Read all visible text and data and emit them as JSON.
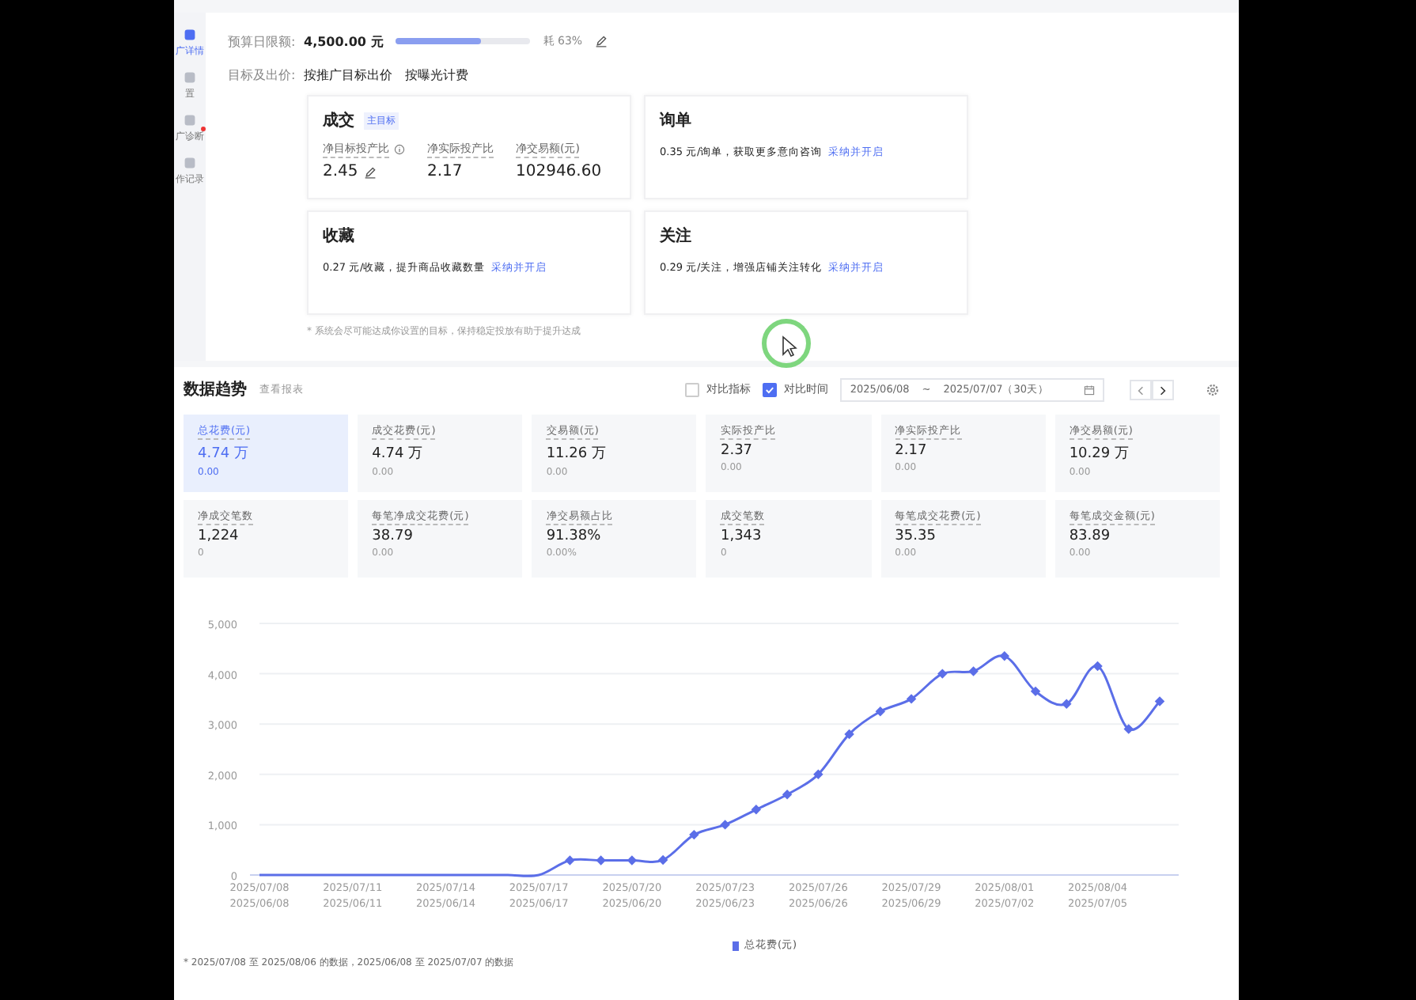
{
  "sidebar": {
    "items": [
      {
        "label": "广详情",
        "selected": true
      },
      {
        "label": "置",
        "selected": false
      },
      {
        "label": "广诊断",
        "selected": false,
        "badge": true
      },
      {
        "label": "作记录",
        "selected": false
      }
    ]
  },
  "budget": {
    "label": "预算日限额:",
    "value": "4,500.00 元",
    "level": 0.63,
    "reading": "耗 63%"
  },
  "bidding": {
    "label": "目标及出价:",
    "options": [
      "按推广目标出价",
      "按曝光计费"
    ]
  },
  "goals": [
    {
      "kind": "main",
      "title": "成交",
      "tag": "主目标",
      "metrics": [
        {
          "label": "净目标投产比",
          "value": "2.45",
          "info": true,
          "editable": true
        },
        {
          "label": "净实际投产比",
          "value": "2.17",
          "info": false,
          "editable": false
        },
        {
          "label": "净交易额(元)",
          "value": "102946.60",
          "info": false,
          "editable": false
        }
      ]
    },
    {
      "kind": "suggest",
      "title": "询单",
      "text": "0.35 元/询单，获取更多意向咨询",
      "link": "采纳并开启"
    },
    {
      "kind": "suggest",
      "title": "收藏",
      "text": "0.27 元/收藏，提升商品收藏数量",
      "link": "采纳并开启"
    },
    {
      "kind": "suggest",
      "title": "关注",
      "text": "0.29 元/关注，增强店铺关注转化",
      "link": "采纳并开启"
    }
  ],
  "goal_note": "* 系统会尽可能达成你设置的目标，保持稳定投放有助于提升达成",
  "trend": {
    "title": "数据趋势",
    "report_link": "查看报表",
    "compare_metric": {
      "label": "对比指标",
      "checked": false
    },
    "compare_time": {
      "label": "对比时间",
      "checked": true
    },
    "date_range": {
      "start": "2025/06/08",
      "separator": "~",
      "end": "2025/07/07（30天）"
    },
    "metrics": [
      {
        "label": "总花费(元)",
        "value": "4.74 万",
        "delta": "0.00",
        "selected": true
      },
      {
        "label": "成交花费(元)",
        "value": "4.74 万",
        "delta": "0.00",
        "selected": false
      },
      {
        "label": "交易额(元)",
        "value": "11.26 万",
        "delta": "0.00",
        "selected": false
      },
      {
        "label": "实际投产比",
        "value": "2.37",
        "delta": "0.00",
        "selected": false
      },
      {
        "label": "净实际投产比",
        "value": "2.17",
        "delta": "0.00",
        "selected": false
      },
      {
        "label": "净交易额(元)",
        "value": "10.29 万",
        "delta": "0.00",
        "selected": false
      },
      {
        "label": "净成交笔数",
        "value": "1,224",
        "delta": "0",
        "selected": false
      },
      {
        "label": "每笔净成交花费(元)",
        "value": "38.79",
        "delta": "0.00",
        "selected": false
      },
      {
        "label": "净交易额占比",
        "value": "91.38%",
        "delta": "0.00%",
        "selected": false
      },
      {
        "label": "成交笔数",
        "value": "1,343",
        "delta": "0",
        "selected": false
      },
      {
        "label": "每笔成交花费(元)",
        "value": "35.35",
        "delta": "0.00",
        "selected": false
      },
      {
        "label": "每笔成交金额(元)",
        "value": "83.89",
        "delta": "0.00",
        "selected": false
      }
    ],
    "compare_labels": [
      "2025/06/08",
      "2025/06/11",
      "2025/06/14",
      "2025/06/17",
      "2025/06/20",
      "2025/06/23",
      "2025/06/26",
      "2025/06/29",
      "2025/07/02",
      "2025/07/05"
    ],
    "chart_data": {
      "type": "line",
      "grid": true,
      "categories": [
        "2025/07/08",
        null,
        null,
        "2025/07/11",
        null,
        null,
        "2025/07/14",
        null,
        null,
        "2025/07/17",
        null,
        null,
        "2025/07/20",
        null,
        null,
        "2025/07/23",
        null,
        null,
        "2025/07/26",
        null,
        null,
        "2025/07/29",
        null,
        null,
        "2025/08/01",
        null,
        null,
        "2025/08/04",
        null,
        null
      ],
      "series": [
        {
          "name": "总花费(元)",
          "color": "#5b6ee8",
          "values": [
            0,
            0,
            0,
            0,
            0,
            0,
            0,
            0,
            0,
            0,
            290,
            290,
            290,
            300,
            800,
            1000,
            1300,
            1600,
            2000,
            2800,
            3250,
            3500,
            4000,
            4050,
            4350,
            3650,
            3400,
            4150,
            2900,
            3450
          ]
        }
      ],
      "ylim": [
        0,
        5000
      ],
      "yticks": [
        {
          "value": 0,
          "label": "0"
        },
        {
          "value": 1000,
          "label": "1,000"
        },
        {
          "value": 2000,
          "label": "2,000"
        },
        {
          "value": 3000,
          "label": "3,000"
        },
        {
          "value": 4000,
          "label": "4,000"
        },
        {
          "value": 5000,
          "label": "5,000"
        }
      ]
    },
    "footnote": "* 2025/07/08 至 2025/08/06 的数据，2025/06/08 至 2025/07/07 的数据"
  }
}
